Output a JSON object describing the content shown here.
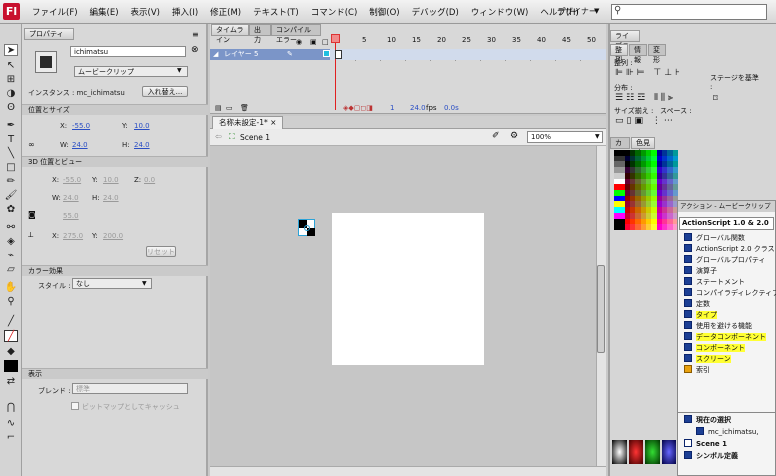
{
  "app": {
    "logo": "Fl",
    "menus": [
      "ファイル(F)",
      "編集(E)",
      "表示(V)",
      "挿入(I)",
      "修正(M)",
      "テキスト(T)",
      "コマンド(C)",
      "制御(O)",
      "デバッグ(D)",
      "ウィンドウ(W)",
      "ヘルプ(H)"
    ],
    "workspace": "デザイナー"
  },
  "properties": {
    "tab": "プロパティ",
    "instance_name": "ichimatsu",
    "symbol_type": "ムービークリップ",
    "instance_label": "インスタンス : mc_ichimatsu",
    "swap_button": "入れ替え...",
    "pos_size_header": "位置とサイズ",
    "x_label": "X:",
    "x": "-55.0",
    "y_label": "Y:",
    "y": "10.0",
    "w_label": "W:",
    "w": "24.0",
    "h_label": "H:",
    "h": "24.0",
    "view3d_header": "3D 位置とビュー",
    "x3d": "-55.0",
    "y3d": "10.0",
    "z_label": "Z:",
    "z3d": "0.0",
    "w3d": "24.0",
    "h3d": "24.0",
    "perspective": "55.0",
    "vx": "275.0",
    "vy": "200.0",
    "reset_button": "リセット",
    "color_effect_header": "カラー効果",
    "style_label": "スタイル :",
    "style_value": "なし",
    "display_header": "表示",
    "blend_label": "ブレンド :",
    "blend_value": "標準",
    "cache_label": "ビットマップとしてキャッシュ"
  },
  "timeline": {
    "tabs": [
      "タイムライン",
      "出力",
      "コンパイルエラー"
    ],
    "frame_numbers": [
      "5",
      "10",
      "15",
      "20",
      "25",
      "30",
      "35",
      "40",
      "45",
      "50"
    ],
    "layer_name": "レイヤー 5",
    "current_frame": "1",
    "fps": "24.0",
    "fps_unit": "fps",
    "time": "0.0s"
  },
  "document": {
    "tab": "名称未設定-1*",
    "scene": "Scene 1",
    "zoom": "100%"
  },
  "library": {
    "tab": "ライブラリ",
    "align_tabs": [
      "整列",
      "情報",
      "変形"
    ],
    "align": "整列 :",
    "distribute": "分布 :",
    "match_size": "サイズ揃え :",
    "space": "スペース :",
    "to_stage": "ステージを基準 :",
    "color_tabs": [
      "カラー",
      "色見本"
    ]
  },
  "actions": {
    "title": "アクション - ムービークリップ",
    "version": "ActionScript 1.0 & 2.0",
    "items": [
      {
        "label": "グローバル関数",
        "hl": false
      },
      {
        "label": "ActionScript 2.0 クラス",
        "hl": false
      },
      {
        "label": "グローバルプロパティ",
        "hl": false
      },
      {
        "label": "演算子",
        "hl": false
      },
      {
        "label": "ステートメント",
        "hl": false
      },
      {
        "label": "コンパイラディレクティブ",
        "hl": false
      },
      {
        "label": "定数",
        "hl": false
      },
      {
        "label": "タイプ",
        "hl": true
      },
      {
        "label": "使用を避ける機能",
        "hl": false
      },
      {
        "label": "データコンポーネント",
        "hl": true
      },
      {
        "label": "コンポーネント",
        "hl": true
      },
      {
        "label": "スクリーン",
        "hl": true
      },
      {
        "label": "索引",
        "hl": false
      }
    ],
    "tree": [
      "現在の選択",
      "mc_ichimatsu,",
      "Scene 1",
      "シンボル定義"
    ]
  }
}
